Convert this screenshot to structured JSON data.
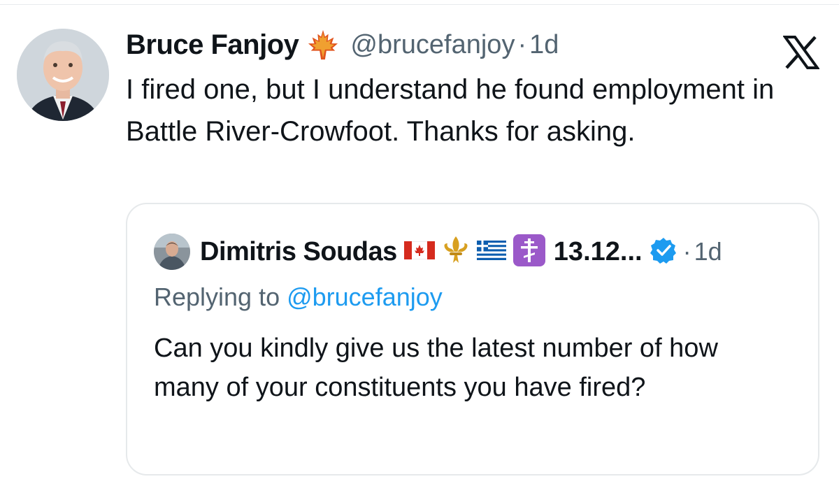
{
  "tweet": {
    "author_name": "Bruce Fanjoy",
    "author_emoji_icon": "maple-leaf-icon",
    "handle": "@brucefanjoy",
    "separator": "·",
    "time": "1d",
    "text": "I fired one, but I understand he found employment in Battle River-Crowfoot. Thanks for asking."
  },
  "app": {
    "logo_icon": "x-logo-icon"
  },
  "quoted": {
    "author_name": "Dimitris Soudas",
    "emoji_icons": [
      "canada-flag-icon",
      "fleur-de-lis-icon",
      "greece-flag-icon",
      "orthodox-cross-icon"
    ],
    "truncated_name": "13.12...",
    "verified_icon": "verified-badge-icon",
    "separator": "·",
    "time": "1d",
    "replying_prefix": "Replying to ",
    "replying_mention": "@brucefanjoy",
    "text": "Can you kindly give us the latest number of how many of your constituents you have fired?"
  },
  "colors": {
    "text": "#0f1419",
    "secondary": "#536471",
    "accent": "#1d9bf0",
    "border": "#e6e9eb"
  }
}
